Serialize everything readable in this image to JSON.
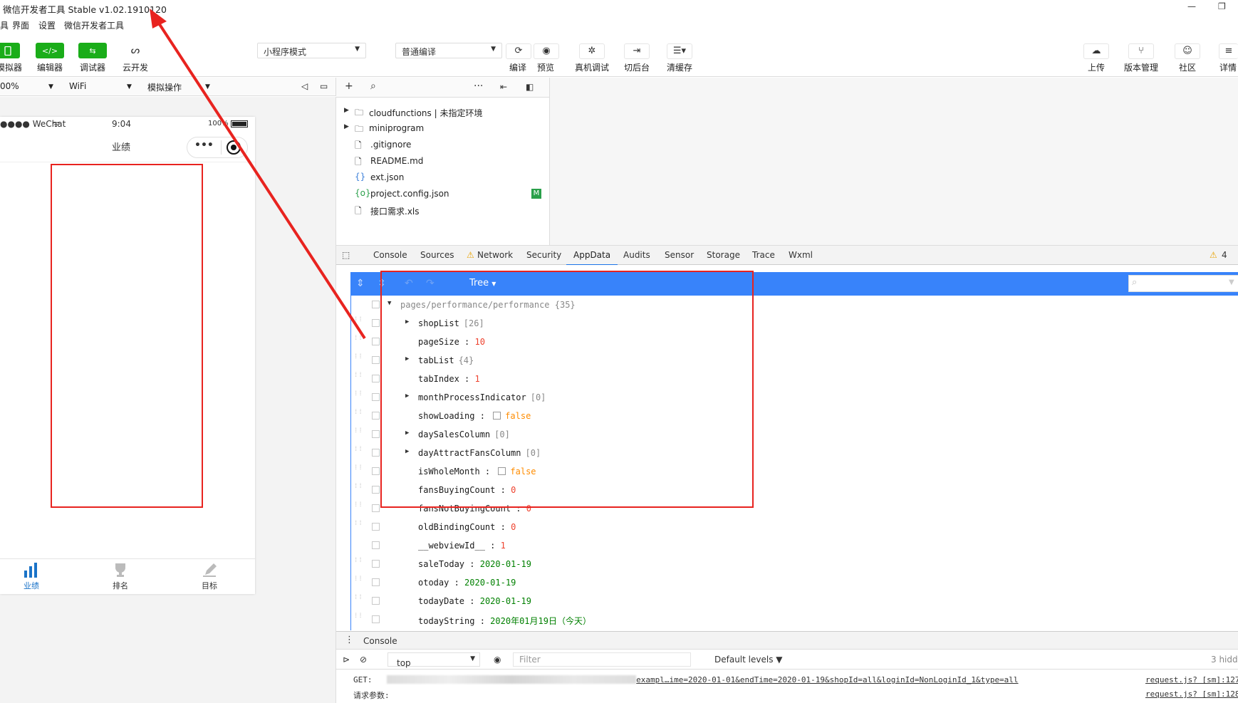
{
  "window": {
    "title": "微信开发者工具 Stable v1.02.1910120",
    "min": "—",
    "restore": "❐"
  },
  "menu": [
    "具",
    "界面",
    "设置",
    "微信开发者工具"
  ],
  "toolbar": {
    "simulator": "模拟器",
    "editor": "编辑器",
    "debugger": "调试器",
    "cloud": "云开发",
    "mode_select": "小程序模式",
    "compile_select": "普通编译",
    "compile": "编译",
    "preview": "预览",
    "real_debug": "真机调试",
    "background": "切后台",
    "clear_cache": "清缓存",
    "upload": "上传",
    "version": "版本管理",
    "community": "社区",
    "details": "详情"
  },
  "simbar": {
    "zoom": "00%",
    "network": "WiFi",
    "ops": "模拟操作"
  },
  "phone": {
    "carrier": "●●●● WeChat",
    "time": "9:04",
    "battery": "100%",
    "page_title": "业绩",
    "capsule_more": "•••",
    "tabs": [
      "业绩",
      "排名",
      "目标"
    ],
    "active_tab_color": "#1a73c8"
  },
  "files": [
    {
      "name": "cloudfunctions | 未指定环境",
      "icon": "cloud-folder-icon",
      "expandable": true
    },
    {
      "name": "miniprogram",
      "icon": "folder-icon",
      "expandable": true
    },
    {
      "name": ".gitignore",
      "icon": "file-icon",
      "expandable": false
    },
    {
      "name": "README.md",
      "icon": "file-icon",
      "expandable": false
    },
    {
      "name": "ext.json",
      "icon": "json-icon",
      "expandable": false
    },
    {
      "name": "project.config.json",
      "icon": "config-icon",
      "expandable": false,
      "badge": "M"
    },
    {
      "name": "接口需求.xls",
      "icon": "file-icon",
      "expandable": false
    }
  ],
  "devtools": {
    "tabs": [
      "Console",
      "Sources",
      "Network",
      "Security",
      "AppData",
      "Audits",
      "Sensor",
      "Storage",
      "Trace",
      "Wxml"
    ],
    "active": "AppData",
    "warnings": "4"
  },
  "appdata": {
    "view_mode": "Tree",
    "root": {
      "path": "pages/performance/performance",
      "count": "{35}"
    },
    "rows": [
      {
        "key": "shopList",
        "meta": "[26]",
        "type": "expand"
      },
      {
        "key": "pageSize",
        "value": "10",
        "type": "num"
      },
      {
        "key": "tabList",
        "meta": "{4}",
        "type": "expand"
      },
      {
        "key": "tabIndex",
        "value": "1",
        "type": "num"
      },
      {
        "key": "monthProcessIndicator",
        "meta": "[0]",
        "type": "expand"
      },
      {
        "key": "showLoading",
        "value": "false",
        "type": "bool"
      },
      {
        "key": "daySalesColumn",
        "meta": "[0]",
        "type": "expand"
      },
      {
        "key": "dayAttractFansColumn",
        "meta": "[0]",
        "type": "expand"
      },
      {
        "key": "isWholeMonth",
        "value": "false",
        "type": "bool"
      },
      {
        "key": "fansBuyingCount",
        "value": "0",
        "type": "num"
      },
      {
        "key": "fansNotBuyingCount",
        "value": "0",
        "type": "num"
      },
      {
        "key": "oldBindingCount",
        "value": "0",
        "type": "num"
      },
      {
        "key": "__webviewId__",
        "value": "1",
        "type": "num"
      },
      {
        "key": "saleToday",
        "value": "2020-01-19",
        "type": "str"
      },
      {
        "key": "otoday",
        "value": "2020-01-19",
        "type": "str"
      },
      {
        "key": "todayDate",
        "value": "2020-01-19",
        "type": "str"
      },
      {
        "key": "todayString",
        "value": "2020年01月19日（今天）",
        "type": "str"
      }
    ]
  },
  "console": {
    "tab": "Console",
    "context": "top",
    "filter_placeholder": "Filter",
    "levels": "Default levels ▼",
    "hidden": "3 hidd",
    "log1_prefix": "GET:",
    "log1_url": "exampl…ime=2020-01-01&endTime=2020-01-19&shopId=all&loginId=NonLoginId_1&type=all",
    "log1_src": "request.js? [sm]:127",
    "log2_prefix": "请求参数:",
    "log2_src": "request.js? [sm]:128"
  }
}
